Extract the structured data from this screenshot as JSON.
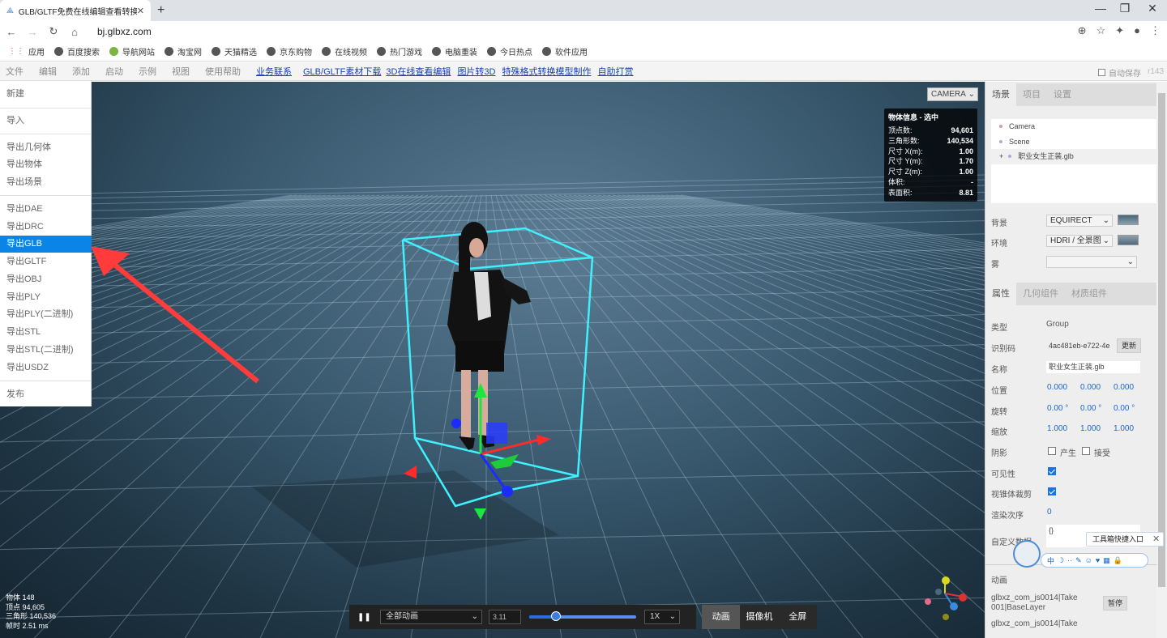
{
  "browser": {
    "tab_title": "GLB/GLTF免费在线编辑查看转换",
    "new_tab": "+",
    "url": "bj.glbxz.com",
    "bookmarks": [
      "应用",
      "百度搜索",
      "导航网站",
      "淘宝网",
      "天猫精选",
      "京东购物",
      "在线视频",
      "热门游戏",
      "电脑重装",
      "今日热点",
      "软件应用"
    ]
  },
  "menubar": {
    "items": [
      "文件",
      "编辑",
      "添加",
      "启动",
      "示例",
      "视图",
      "使用帮助"
    ],
    "links": [
      "业务联系",
      "GLB/GLTF素材下载",
      "3D在线查看编辑",
      "图片转3D",
      "特殊格式转换模型制作",
      "自助打赏"
    ],
    "autosave": "自动保存",
    "version": "r143"
  },
  "file_menu": {
    "items": [
      "新建",
      "导入",
      "导出几何体",
      "导出物体",
      "导出场景",
      "导出DAE",
      "导出DRC",
      "导出GLB",
      "导出GLTF",
      "导出OBJ",
      "导出PLY",
      "导出PLY(二进制)",
      "导出STL",
      "导出STL(二进制)",
      "导出USDZ",
      "发布"
    ],
    "selected": "导出GLB"
  },
  "viewport": {
    "camera_select": "CAMERA",
    "info": {
      "header": "物体信息 - 选中",
      "rows": [
        [
          "顶点数:",
          "94,601"
        ],
        [
          "三角形数:",
          "140,534"
        ],
        [
          "尺寸 X(m):",
          "1.00"
        ],
        [
          "尺寸 Y(m):",
          "1.70"
        ],
        [
          "尺寸 Z(m):",
          "1.00"
        ],
        [
          "体积:",
          "-"
        ],
        [
          "表面积:",
          "8.81"
        ]
      ]
    },
    "stats": {
      "objects": "物体  148",
      "vertices": "顶点  94,605",
      "triangles": "三角形  140,536",
      "frametime": "帧时  2.51 ms"
    }
  },
  "animation_bar": {
    "all_animations": "全部动画",
    "time": "3.11",
    "speed": "1X",
    "progress": 0.25,
    "modes": [
      "动画",
      "摄像机",
      "全屏"
    ],
    "active_mode": "动画"
  },
  "sidebar": {
    "tabs": [
      "场景",
      "项目",
      "设置"
    ],
    "outliner": [
      "Camera",
      "Scene",
      "职业女生正装.glb"
    ],
    "background_label": "背景",
    "background_value": "EQUIRECT",
    "environment_label": "环境",
    "environment_value": "HDRI / 全景图",
    "fog_label": "雾",
    "prop_tabs": [
      "属性",
      "几何组件",
      "材质组件"
    ],
    "type_label": "类型",
    "type_value": "Group",
    "uuid_label": "识别码",
    "uuid_value": "4ac481eb-e722-4e",
    "update_btn": "更新",
    "name_label": "名称",
    "name_value": "职业女生正装.glb",
    "position_label": "位置",
    "position": [
      "0.000",
      "0.000",
      "0.000"
    ],
    "rotation_label": "旋转",
    "rotation": [
      "0.00 °",
      "0.00 °",
      "0.00 °"
    ],
    "scale_label": "缩放",
    "scale": [
      "1.000",
      "1.000",
      "1.000"
    ],
    "shadow_label": "阴影",
    "shadow_cast": "产生",
    "shadow_receive": "接受",
    "visible_label": "可见性",
    "frustum_label": "视锥体裁剪",
    "renderorder_label": "渲染次序",
    "renderorder_value": "0",
    "userdata_label": "自定义数据",
    "userdata_value": "{}",
    "animation_label": "动画",
    "animations": [
      "glbxz_com_js0014|Take 001|BaseLayer",
      "glbxz_com_js0014|Take"
    ],
    "anim_btn": "暂停"
  },
  "tooltip": {
    "text": "工具箱快捷入口",
    "close": "✕",
    "icons": [
      "中",
      "☽",
      "··",
      "✎",
      "☺",
      "♥",
      "▦",
      "🔒"
    ]
  }
}
